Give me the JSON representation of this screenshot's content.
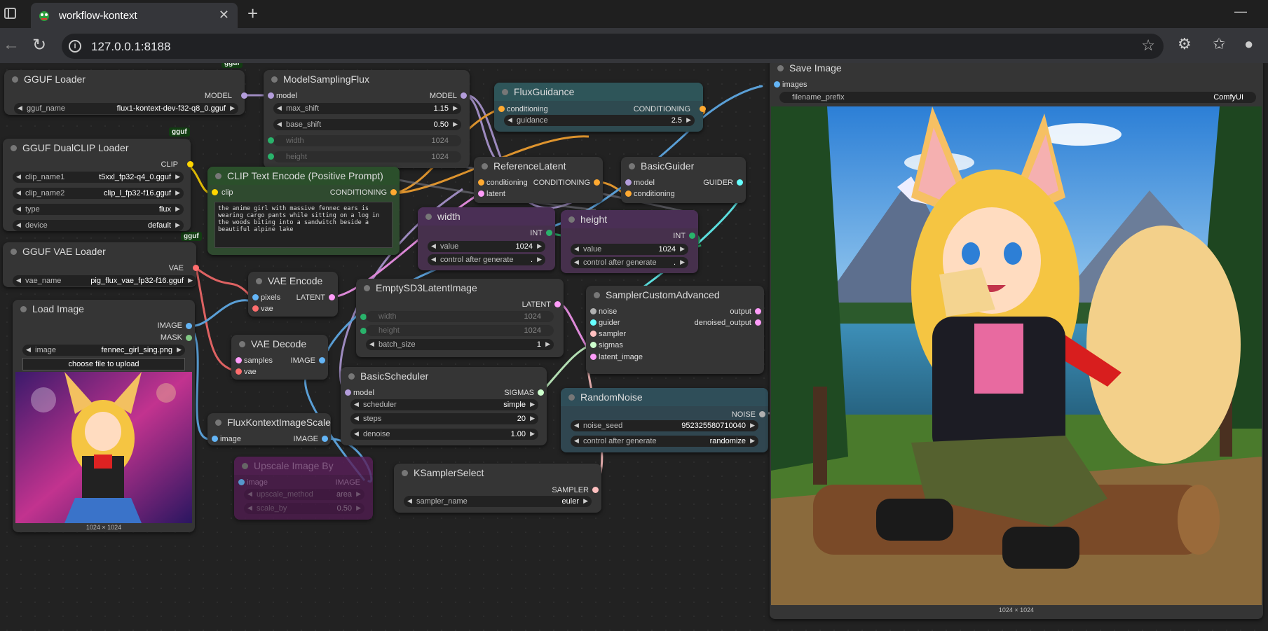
{
  "browser": {
    "tab_title": "workflow-kontext",
    "url": "127.0.0.1:8188"
  },
  "badges": [
    "gguf",
    "gguf",
    "gguf"
  ],
  "nodes": {
    "gguf_loader": {
      "title": "GGUF Loader",
      "output": "MODEL",
      "w_label": "gguf_name",
      "w_value": "flux1-kontext-dev-f32-q8_0.gguf"
    },
    "dualclip": {
      "title": "GGUF DualCLIP Loader",
      "output": "CLIP",
      "widgets": [
        {
          "label": "clip_name1",
          "value": "t5xxl_fp32-q4_0.gguf"
        },
        {
          "label": "clip_name2",
          "value": "clip_l_fp32-f16.gguf"
        },
        {
          "label": "type",
          "value": "flux"
        },
        {
          "label": "device",
          "value": "default"
        }
      ]
    },
    "vae_loader": {
      "title": "GGUF VAE Loader",
      "output": "VAE",
      "w_label": "vae_name",
      "w_value": "pig_flux_vae_fp32-f16.gguf"
    },
    "load_image": {
      "title": "Load Image",
      "out1": "IMAGE",
      "out2": "MASK",
      "w_label": "image",
      "w_value": "fennec_girl_sing.png",
      "upload": "choose file to upload",
      "caption": "1024 × 1024"
    },
    "model_sampling": {
      "title": "ModelSamplingFlux",
      "input": "model",
      "output": "MODEL",
      "widgets": [
        {
          "label": "max_shift",
          "value": "1.15"
        },
        {
          "label": "base_shift",
          "value": "0.50"
        },
        {
          "label": "width",
          "value": "1024"
        },
        {
          "label": "height",
          "value": "1024"
        }
      ]
    },
    "clip_text": {
      "title": "CLIP Text Encode (Positive Prompt)",
      "input": "clip",
      "output": "CONDITIONING",
      "text": "the anime girl with massive fennec ears is wearing cargo pants while sitting on a log in the woods biting into a sandwitch beside a beautiful alpine lake"
    },
    "flux_guidance": {
      "title": "FluxGuidance",
      "input": "conditioning",
      "output": "CONDITIONING",
      "w_label": "guidance",
      "w_value": "2.5"
    },
    "ref_latent": {
      "title": "ReferenceLatent",
      "in1": "conditioning",
      "in2": "latent",
      "output": "CONDITIONING"
    },
    "basic_guider": {
      "title": "BasicGuider",
      "in1": "model",
      "in2": "conditioning",
      "output": "GUIDER"
    },
    "width": {
      "title": "width",
      "output": "INT",
      "w1_label": "value",
      "w1_value": "1024",
      "w2_label": "control after generate",
      "w2_value": "."
    },
    "height": {
      "title": "height",
      "output": "INT",
      "w1_label": "value",
      "w1_value": "1024",
      "w2_label": "control after generate",
      "w2_value": "."
    },
    "vae_encode": {
      "title": "VAE Encode",
      "in1": "pixels",
      "in2": "vae",
      "output": "LATENT"
    },
    "empty_latent": {
      "title": "EmptySD3LatentImage",
      "output": "LATENT",
      "widgets": [
        {
          "label": "width",
          "value": "1024"
        },
        {
          "label": "height",
          "value": "1024"
        },
        {
          "label": "batch_size",
          "value": "1"
        }
      ]
    },
    "sampler_custom": {
      "title": "SamplerCustomAdvanced",
      "inputs": [
        "noise",
        "guider",
        "sampler",
        "sigmas",
        "latent_image"
      ],
      "out1": "output",
      "out2": "denoised_output"
    },
    "vae_decode": {
      "title": "VAE Decode",
      "in1": "samples",
      "in2": "vae",
      "output": "IMAGE"
    },
    "basic_scheduler": {
      "title": "BasicScheduler",
      "input": "model",
      "output": "SIGMAS",
      "widgets": [
        {
          "label": "scheduler",
          "value": "simple"
        },
        {
          "label": "steps",
          "value": "20"
        },
        {
          "label": "denoise",
          "value": "1.00"
        }
      ]
    },
    "random_noise": {
      "title": "RandomNoise",
      "output": "NOISE",
      "w1_label": "noise_seed",
      "w1_value": "952325580710040",
      "w2_label": "control after generate",
      "w2_value": "randomize"
    },
    "flux_scale": {
      "title": "FluxKontextImageScale",
      "input": "image",
      "output": "IMAGE"
    },
    "upscale": {
      "title": "Upscale Image By",
      "input": "image",
      "output": "IMAGE",
      "w1_label": "upscale_method",
      "w1_value": "area",
      "w2_label": "scale_by",
      "w2_value": "0.50"
    },
    "ksampler_select": {
      "title": "KSamplerSelect",
      "output": "SAMPLER",
      "w_label": "sampler_name",
      "w_value": "euler"
    },
    "save_image": {
      "title": "Save Image",
      "input": "images",
      "w_label": "filename_prefix",
      "w_value": "ComfyUI",
      "caption": "1024 × 1024"
    }
  },
  "colors": {
    "model": "#b39ddb",
    "clip": "#ffd500",
    "vae": "#ff6e6e",
    "conditioning": "#ffa931",
    "latent": "#ff9cf9",
    "image": "#64b5f6",
    "int": "#29b36b",
    "sigmas": "#cdffcd",
    "guider": "#66ffff",
    "noise": "#b0b0b0",
    "sampler": "#ffc0c0"
  }
}
